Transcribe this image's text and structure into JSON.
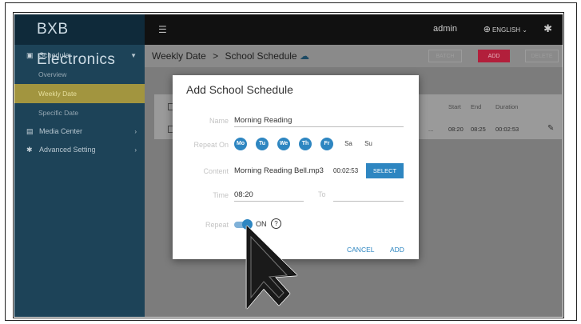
{
  "brand": "BXB Electronics",
  "sidebar": {
    "schedule": "Schedule",
    "overview": "Overview",
    "weekly": "Weekly Date",
    "specific": "Specific Date",
    "media": "Media Center",
    "advanced": "Advanced Setting"
  },
  "topbar": {
    "user": "admin",
    "language": "ENGLISH"
  },
  "breadcrumb": {
    "section": "Weekly Date",
    "sep": ">",
    "page": "School Schedule"
  },
  "toolbar": {
    "batch": "BATCH",
    "add": "ADD",
    "delete": "DELETE"
  },
  "table": {
    "headers": {
      "start": "Start",
      "end": "End",
      "duration": "Duration"
    },
    "row": {
      "start": "08:20",
      "end": "08:25",
      "duration": "00:02:53"
    }
  },
  "dialog": {
    "title": "Add School Schedule",
    "name_label": "Name",
    "name_value": "Morning Reading",
    "repeat_on_label": "Repeat On",
    "days": [
      {
        "label": "Mo",
        "on": true
      },
      {
        "label": "Tu",
        "on": true
      },
      {
        "label": "We",
        "on": true
      },
      {
        "label": "Th",
        "on": true
      },
      {
        "label": "Fr",
        "on": true
      },
      {
        "label": "Sa",
        "on": false
      },
      {
        "label": "Su",
        "on": false
      }
    ],
    "content_label": "Content",
    "content_file": "Morning Reading Bell.mp3",
    "content_duration": "00:02:53",
    "select_label": "SELECT",
    "time_label": "Time",
    "time_value": "08:20",
    "to_label": "To",
    "repeat_label": "Repeat",
    "repeat_state": "ON",
    "help": "?",
    "cancel": "CANCEL",
    "add": "ADD"
  },
  "colors": {
    "accent": "#2e86c1",
    "add_button": "#b21f3b",
    "sidebar": "#1d4358",
    "active_item": "#a2953f"
  }
}
